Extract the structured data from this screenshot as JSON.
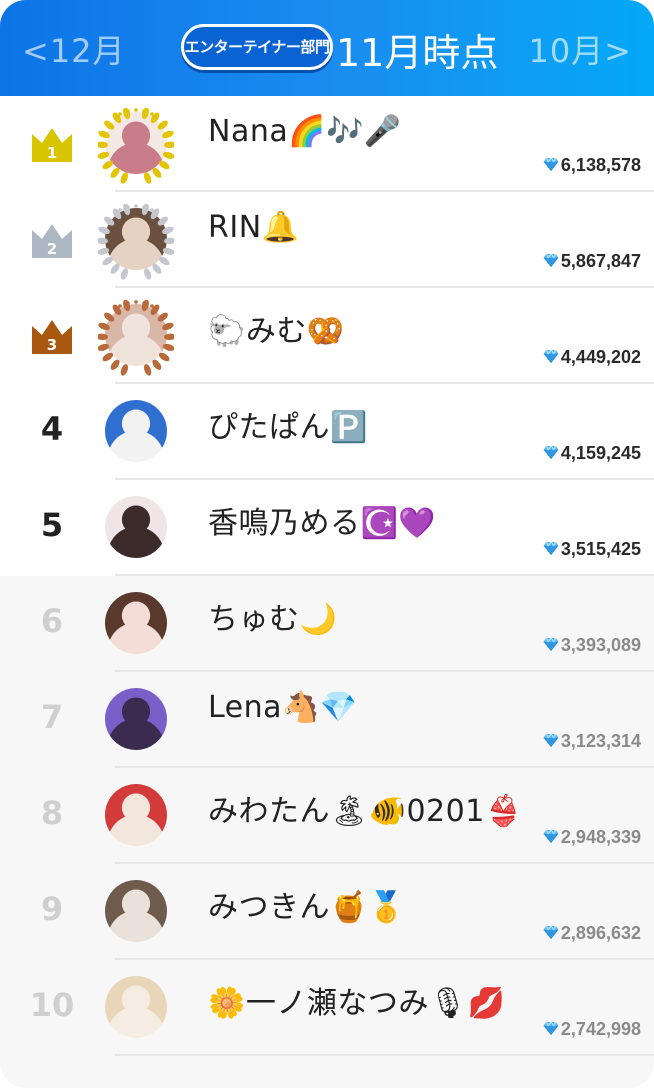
{
  "header": {
    "prev_label": "<12月",
    "next_label": "10月>",
    "department": "エンターテイナー部門",
    "period": "11月時点",
    "colors": {
      "start": "#0c74e6",
      "end": "#05a8f6"
    }
  },
  "ranking": [
    {
      "rank": "1",
      "name": "Nana🌈🎶🎤",
      "score": "6,138,578",
      "crown": "gold",
      "avatar_colors": [
        "#f2e9e4",
        "#c97d8a"
      ]
    },
    {
      "rank": "2",
      "name": "RIN🔔",
      "score": "5,867,847",
      "crown": "silver",
      "avatar_colors": [
        "#6b4f3f",
        "#e6d2c2"
      ]
    },
    {
      "rank": "3",
      "name": "🐑みむ🥨",
      "score": "4,449,202",
      "crown": "bronze",
      "avatar_colors": [
        "#d9b7a6",
        "#efe3dc"
      ]
    },
    {
      "rank": "4",
      "name": "ぴたぱん🅿️",
      "score": "4,159,245",
      "crown": "",
      "avatar_colors": [
        "#2f6fd0",
        "#f2f2f2"
      ]
    },
    {
      "rank": "5",
      "name": "香鳴乃める☪️💜",
      "score": "3,515,425",
      "crown": "",
      "avatar_colors": [
        "#f1e4e6",
        "#3b2b2b"
      ]
    },
    {
      "rank": "6",
      "name": "ちゅむ🌙",
      "score": "3,393,089",
      "crown": "",
      "avatar_colors": [
        "#5b3a2e",
        "#f4ddd6"
      ]
    },
    {
      "rank": "7",
      "name": "Lena🐴💎",
      "score": "3,123,314",
      "crown": "",
      "avatar_colors": [
        "#7b5fc9",
        "#3a2b4f"
      ]
    },
    {
      "rank": "8",
      "name": "みわたん🏝🐠0201👙",
      "score": "2,948,339",
      "crown": "",
      "avatar_colors": [
        "#d33b3b",
        "#f3e6dd"
      ]
    },
    {
      "rank": "9",
      "name": "みつきん🍯🥇",
      "score": "2,896,632",
      "crown": "",
      "avatar_colors": [
        "#6e5b4b",
        "#eae2da"
      ]
    },
    {
      "rank": "10",
      "name": "🌼一ノ瀬なつみ🎙💋",
      "score": "2,742,998",
      "crown": "",
      "avatar_colors": [
        "#e9d6b8",
        "#f5ede3"
      ]
    }
  ]
}
